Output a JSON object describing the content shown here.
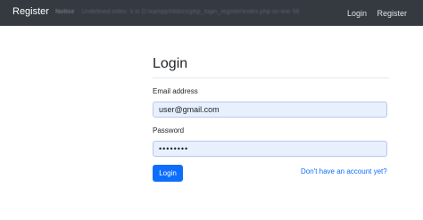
{
  "navbar": {
    "brand": "Register",
    "notice_label": "Notice",
    "notice_text": ": Undefined index: ti in D:\\xampp\\htdocs\\php_login_register\\index.php on line 58",
    "links": [
      "Login",
      "Register"
    ]
  },
  "form": {
    "title": "Login",
    "email_label": "Email address",
    "email_value": "user@gmail.com",
    "password_label": "Password",
    "password_value": "••••••••",
    "submit_label": "Login",
    "signup_link": "Don't have an account yet?"
  },
  "colors": {
    "navbar_bg": "#343a40",
    "primary": "#0d6efd",
    "autofill_bg": "#e8f0fe"
  }
}
